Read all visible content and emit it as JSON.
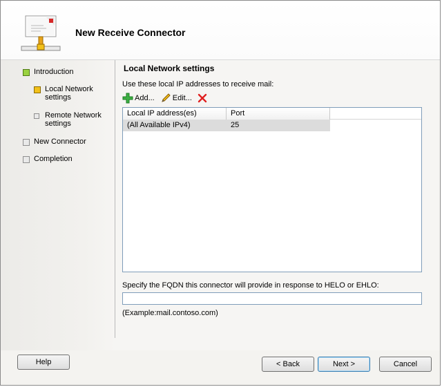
{
  "window": {
    "title": "New Receive Connector"
  },
  "nav": {
    "items": [
      {
        "label": "Introduction",
        "state": "complete"
      },
      {
        "label": "Local Network settings",
        "state": "current",
        "sub": true
      },
      {
        "label": "Remote Network settings",
        "state": "pending",
        "sub": true
      },
      {
        "label": "New Connector",
        "state": "pending"
      },
      {
        "label": "Completion",
        "state": "pending"
      }
    ]
  },
  "main": {
    "section_title": "Local Network settings",
    "instructions": "Use these local IP addresses to receive mail:",
    "toolbar": {
      "add_label": "Add...",
      "edit_label": "Edit...",
      "icons": [
        "add-icon",
        "edit-pencil-icon",
        "delete-x-icon"
      ]
    },
    "table": {
      "columns": [
        "Local IP address(es)",
        "Port"
      ],
      "rows": [
        {
          "address": "(All Available IPv4)",
          "port": "25",
          "selected": true
        }
      ]
    },
    "fqdn_label": "Specify the FQDN this connector will provide in response to HELO or EHLO:",
    "fqdn_value": "",
    "example": "(Example:mail.contoso.com)"
  },
  "footer": {
    "help_label": "Help",
    "back_label": "< Back",
    "next_label": "Next >",
    "cancel_label": "Cancel"
  },
  "colors": {
    "complete": "#9ad240",
    "current": "#f2c11a",
    "pending": "#e9e9e9",
    "list_border": "#7f9db9"
  }
}
